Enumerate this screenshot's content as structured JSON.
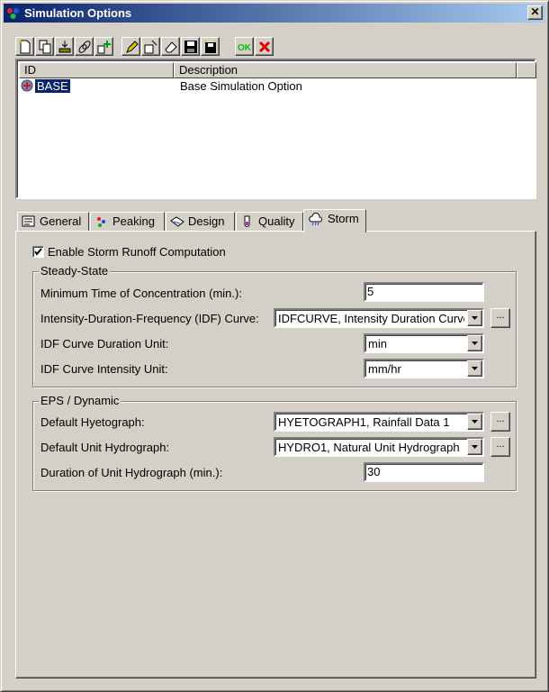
{
  "window": {
    "title": "Simulation Options",
    "close_glyph": "✕"
  },
  "toolbar": {
    "buttons": [
      {
        "name": "new-icon"
      },
      {
        "name": "duplicate-icon"
      },
      {
        "name": "import-icon"
      },
      {
        "name": "link-icon"
      },
      {
        "name": "add-icon"
      },
      {
        "name": "edit-icon"
      },
      {
        "name": "rename-icon"
      },
      {
        "name": "erase-icon"
      },
      {
        "name": "save-icon"
      },
      {
        "name": "save-all-icon"
      },
      {
        "name": "ok-icon",
        "label": "OK"
      },
      {
        "name": "cancel-icon"
      }
    ]
  },
  "list": {
    "columns": [
      "ID",
      "Description"
    ],
    "rows": [
      {
        "id": "BASE",
        "description": "Base Simulation Option"
      }
    ]
  },
  "tabs": [
    {
      "label": "General",
      "icon": "general-icon"
    },
    {
      "label": "Peaking",
      "icon": "peaking-icon"
    },
    {
      "label": "Design",
      "icon": "design-icon"
    },
    {
      "label": "Quality",
      "icon": "quality-icon"
    },
    {
      "label": "Storm",
      "icon": "storm-icon",
      "active": true
    }
  ],
  "storm": {
    "enable_label": "Enable Storm Runoff Computation",
    "enable_checked": true,
    "steady_state": {
      "title": "Steady-State",
      "min_time_label": "Minimum Time of Concentration (min.):",
      "min_time_value": "5",
      "idf_curve_label": "Intensity-Duration-Frequency (IDF) Curve:",
      "idf_curve_value": "IDFCURVE, Intensity Duration Curve",
      "duration_unit_label": "IDF Curve Duration Unit:",
      "duration_unit_value": "min",
      "intensity_unit_label": "IDF Curve Intensity Unit:",
      "intensity_unit_value": "mm/hr"
    },
    "eps": {
      "title": "EPS / Dynamic",
      "hyetograph_label": "Default Hyetograph:",
      "hyetograph_value": "HYETOGRAPH1, Rainfall Data 1",
      "unit_hydro_label": "Default Unit Hydrograph:",
      "unit_hydro_value": "HYDRO1, Natural Unit Hydrograph",
      "duration_label": "Duration of Unit Hydrograph (min.):",
      "duration_value": "30"
    },
    "ellipsis": "..."
  },
  "colors": {
    "title_start": "#0a246a",
    "title_end": "#a6caf0",
    "selection": "#0a246a",
    "face": "#d4d0c8"
  }
}
